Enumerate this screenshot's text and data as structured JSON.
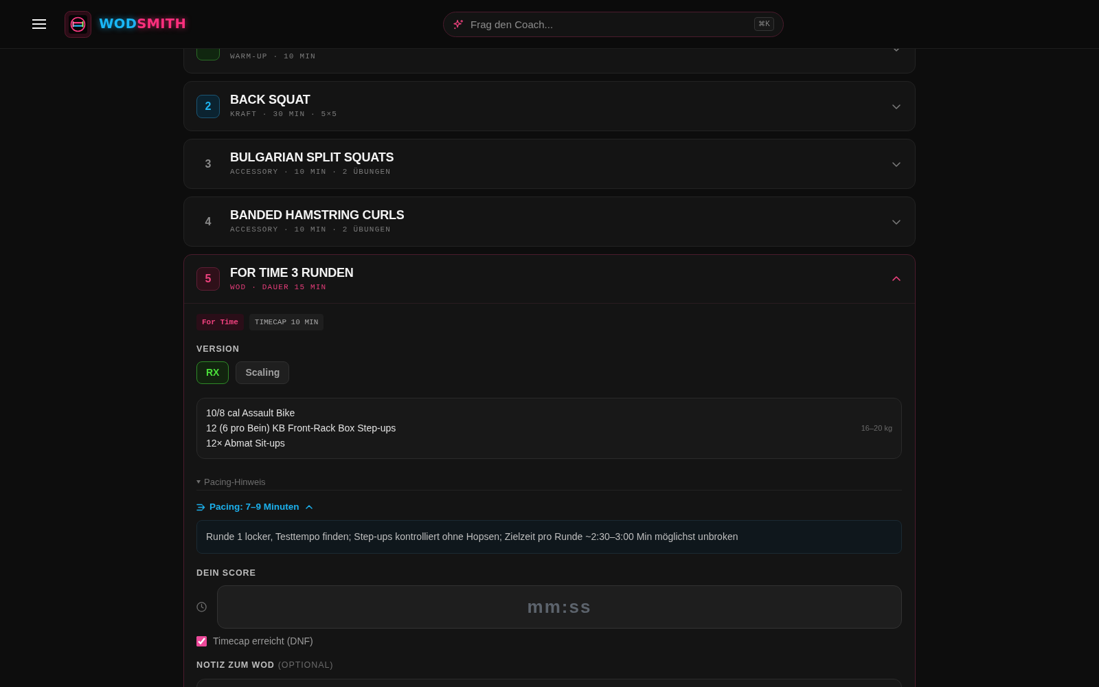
{
  "header": {
    "logo": {
      "left": "WOD",
      "right": "SMITH"
    },
    "search": {
      "placeholder": "Frag den Coach...",
      "shortcut": "⌘K"
    }
  },
  "sections": [
    {
      "kind": "warmup",
      "subtitle": "WARM-UP · 10 MIN",
      "expanded": false
    },
    {
      "kind": "strength",
      "number": "2",
      "title": "BACK SQUAT",
      "subtitle": "KRAFT · 30 MIN · 5×5",
      "expanded": false
    },
    {
      "kind": "accessory",
      "number": "3",
      "title": "BULGARIAN SPLIT SQUATS",
      "subtitle": "ACCESSORY · 10 MIN · 2 ÜBUNGEN",
      "expanded": false
    },
    {
      "kind": "accessory",
      "number": "4",
      "title": "BANDED HAMSTRING CURLS",
      "subtitle": "ACCESSORY · 10 MIN · 2 ÜBUNGEN",
      "expanded": false
    },
    {
      "kind": "wod",
      "number": "5",
      "title": "FOR TIME 3 RUNDEN",
      "subtitle": "WOD · DAUER 15 MIN",
      "expanded": true,
      "detail": {
        "tags": [
          {
            "kind": "format",
            "label": "For Time"
          },
          {
            "kind": "info",
            "label": "TIMECAP 10 MIN"
          }
        ],
        "version_label": "VERSION",
        "versions": [
          {
            "label": "RX",
            "selected": true
          },
          {
            "label": "Scaling",
            "selected": false
          }
        ],
        "movements": [
          {
            "text": "10/8 cal Assault Bike"
          },
          {
            "text": "12 (6 pro Bein) KB Front-Rack Box Step-ups",
            "weight": "16–20 kg"
          },
          {
            "text": "12× Abmat Sit-ups"
          }
        ],
        "hint_toggle": "Pacing-Hinweis",
        "pacing": {
          "title": "Pacing: 7–9 Minuten",
          "expanded": true,
          "text": "Runde 1 locker, Testtempo finden; Step-ups kontrolliert ohne Hopsen; Zielzeit pro Runde ~2:30–3:00 Min möglichst unbroken"
        },
        "score": {
          "label": "DEIN SCORE",
          "placeholder": "mm:ss"
        },
        "dnf": {
          "label": "Timecap erreicht (DNF)",
          "checked": true
        },
        "note": {
          "label": "NOTIZ ZUM WOD",
          "hint": "(OPTIONAL)"
        }
      }
    }
  ]
}
